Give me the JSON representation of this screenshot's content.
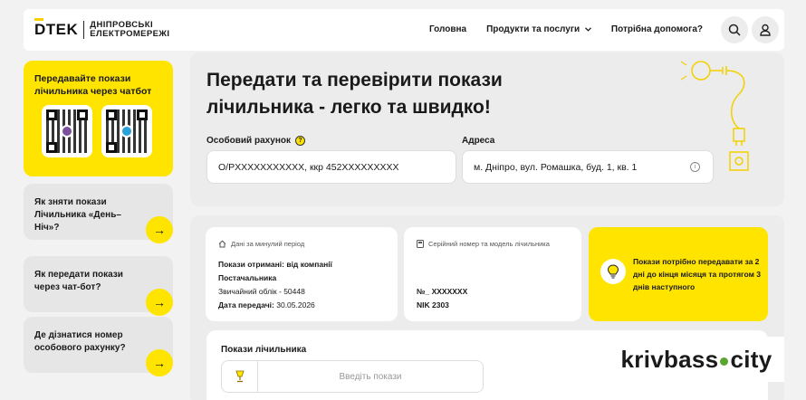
{
  "header": {
    "logo_mark": "DTEK",
    "logo_line1": "ДНІПРОВСЬКІ",
    "logo_line2": "ЕЛЕКТРОМЕРЕЖІ",
    "nav": [
      "Головна",
      "Продукти та послуги",
      "Потрібна допомога?"
    ]
  },
  "sidebar": {
    "qr_title": "Передавайте покази лічильника через чатбот",
    "qr_codes": [
      {
        "icon": "viber-icon",
        "color": "#7b519d"
      },
      {
        "icon": "telegram-icon",
        "color": "#2aa1da"
      }
    ],
    "faq": [
      "Як зняти покази Лічильника «День–Ніч»?",
      "Як передати покази через чат-бот?",
      "Де дізнатися номер особового рахунку?"
    ],
    "arrow": "→"
  },
  "main": {
    "title": "Передати та перевірити покази лічильника - легко та швидко!",
    "account_label": "Особовий рахунок",
    "account_value": "О/РXXXXXXXXXXX, ккр 452XXXXXXXXX",
    "address_label": "Адреса",
    "address_value": "м. Дніпро, вул. Ромашка, буд. 1, кв. 1"
  },
  "prev_period": {
    "caption": "Дані за минулий період",
    "received_label": "Покази отримані: від компанії Постачальника",
    "meter_type": "Звичайний облік - 50448",
    "date_label": "Дата передачі:",
    "date_value": "30.05.2026"
  },
  "meter": {
    "caption": "Серійний номер та модель лічильника",
    "serial": "№_ XXXXXXX",
    "model": "NIK 2303"
  },
  "note": {
    "text": "Покази потрібно передавати за 2 дні до кінця місяця та протягом 3 днів наступного"
  },
  "readings": {
    "label": "Покази лічильника",
    "placeholder": "Введіть покази"
  },
  "watermark": {
    "part1": "krivbass",
    "part2": "city"
  },
  "colors": {
    "accent": "#ffe400",
    "watermark_dot": "#5aa62c"
  }
}
